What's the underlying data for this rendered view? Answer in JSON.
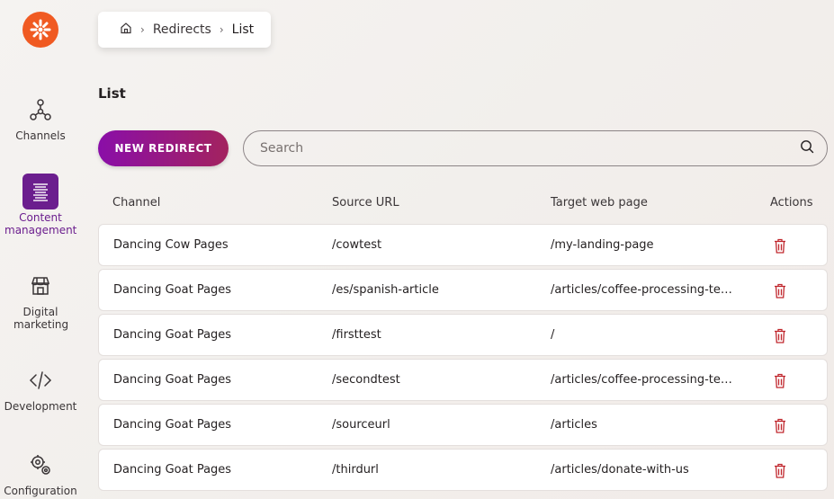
{
  "sidebar": {
    "items": [
      {
        "label": "Channels",
        "icon": "channels-icon"
      },
      {
        "label": "Content management",
        "icon": "content-management-icon",
        "active": true
      },
      {
        "label": "Digital marketing",
        "icon": "storefront-icon"
      },
      {
        "label": "Development",
        "icon": "code-icon"
      },
      {
        "label": "Configuration",
        "icon": "gears-icon"
      }
    ]
  },
  "breadcrumb": {
    "items": [
      "Redirects",
      "List"
    ]
  },
  "page": {
    "title": "List",
    "new_button_label": "NEW REDIRECT",
    "search_placeholder": "Search"
  },
  "table": {
    "columns": [
      "Channel",
      "Source URL",
      "Target web page",
      "Actions"
    ],
    "rows": [
      {
        "channel": "Dancing Cow Pages",
        "source": "/cowtest",
        "target": "/my-landing-page"
      },
      {
        "channel": "Dancing Goat Pages",
        "source": "/es/spanish-article",
        "target": "/articles/coffee-processing-tec..."
      },
      {
        "channel": "Dancing Goat Pages",
        "source": "/firsttest",
        "target": "/"
      },
      {
        "channel": "Dancing Goat Pages",
        "source": "/secondtest",
        "target": "/articles/coffee-processing-tec..."
      },
      {
        "channel": "Dancing Goat Pages",
        "source": "/sourceurl",
        "target": "/articles"
      },
      {
        "channel": "Dancing Goat Pages",
        "source": "/thirdurl",
        "target": "/articles/donate-with-us"
      }
    ]
  },
  "colors": {
    "brand_orange": "#f05a22",
    "accent_purple": "#6b1e8e",
    "delete_red": "#c0272d"
  }
}
